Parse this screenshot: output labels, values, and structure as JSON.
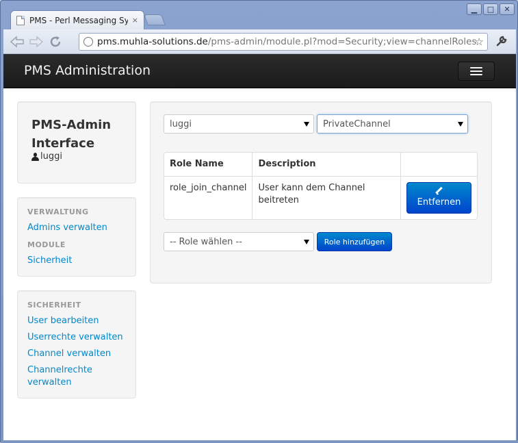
{
  "browser": {
    "tab_title": "PMS - Perl Messaging System",
    "tab_close": "×",
    "url_host": "pms.muhla-solutions.de",
    "url_path": "/pms-admin/module.pl?mod=Security;view=channelRoles",
    "window_controls": {
      "minimize": "▁",
      "maximize": "□",
      "close": "✕"
    },
    "nav_icons": {
      "back": "back-arrow-icon",
      "forward": "forward-arrow-icon",
      "reload": "reload-icon"
    }
  },
  "navbar": {
    "brand": "PMS Administration"
  },
  "sidebar": {
    "title": "PMS-Admin Interface",
    "user": "luggi",
    "verwaltung_header": "VERWALTUNG",
    "admins_link": "Admins verwalten",
    "module_header": "MODULE",
    "sicherheit_link": "Sicherheit",
    "security_header": "SICHERHEIT",
    "security_links": [
      "User bearbeiten",
      "Userrechte verwalten",
      "Channel verwalten",
      "Channelrechte verwalten"
    ]
  },
  "main": {
    "user_select": "luggi",
    "channel_select": "PrivateChannel",
    "table": {
      "headers": [
        "Role Name",
        "Description",
        ""
      ],
      "rows": [
        {
          "role": "role_join_channel",
          "description": "User kann dem Channel beitreten",
          "action": "Entfernen"
        }
      ]
    },
    "role_select_placeholder": "-- Role wählen --",
    "add_role_button": "Role hinzufügen"
  },
  "colors": {
    "navbar_bg": "#1b1b1b",
    "link": "#0088cc",
    "primary_button": "#0055cc",
    "well_bg": "#f5f5f5"
  }
}
